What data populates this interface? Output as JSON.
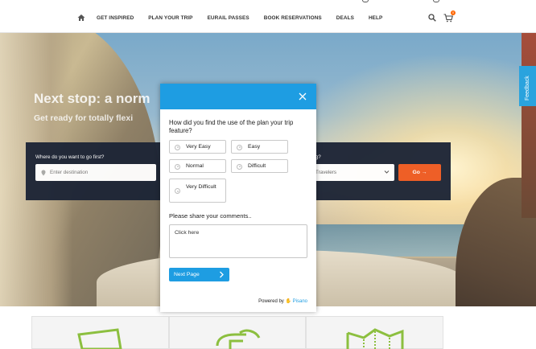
{
  "nav": {
    "items": [
      "GET INSPIRED",
      "PLAN YOUR TRIP",
      "EURAIL PASSES",
      "BOOK RESERVATIONS",
      "DEALS",
      "HELP"
    ],
    "cart_count": "0"
  },
  "hero": {
    "title": "Next stop: a norm",
    "subtitle": "Get ready for totally flexi",
    "dest_label": "Where do you want to go first?",
    "dest_placeholder": "Enter destination",
    "trav_label": "eling?",
    "trav_value": "Travelers",
    "go_label": "Go →"
  },
  "feedback_label": "Feedback",
  "survey": {
    "question": "How did you find the use of the plan your trip feature?",
    "options": [
      "Very Easy",
      "Easy",
      "Normal",
      "Difficult",
      "Very Difficult"
    ],
    "comments_label": "Please share your comments..",
    "comments_placeholder": "Click here",
    "next_label": "Next Page",
    "powered_prefix": "Powered by",
    "powered_brand": "Pisano"
  },
  "colors": {
    "accent_blue": "#1e9de2",
    "go_orange": "#ee5a21",
    "icon_green": "#8cbf3f",
    "panel_dark": "#1d2536"
  }
}
